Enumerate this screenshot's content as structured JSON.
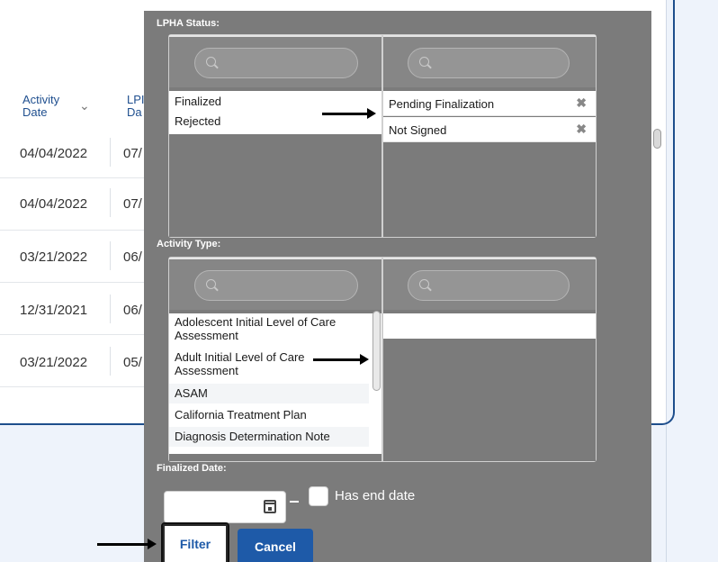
{
  "background_table": {
    "headers": {
      "activity_date": "Activity\nDate",
      "lpha_date": "LPHA\nDate"
    },
    "header_partial_lpha": "LPI",
    "header_partial_lpha_2": "Da",
    "rows": [
      {
        "activity_date": "04/04/2022",
        "lpha_date_partial": "07/"
      },
      {
        "activity_date": "04/04/2022",
        "lpha_date_partial": "07/"
      },
      {
        "activity_date": "03/21/2022",
        "lpha_date_partial": "06/"
      },
      {
        "activity_date": "12/31/2021",
        "lpha_date_partial": "06/"
      },
      {
        "activity_date": "03/21/2022",
        "lpha_date_partial": "05/"
      }
    ]
  },
  "filter_modal": {
    "lpha_status": {
      "label": "LPHA Status:",
      "available": [
        "Finalized",
        "Rejected"
      ],
      "selected": [
        "Pending Finalization",
        "Not Signed"
      ],
      "remove_glyph": "✖"
    },
    "activity_type": {
      "label": "Activity Type:",
      "available": [
        "Adolescent Initial Level of Care Assessment",
        "Adult Initial Level of Care Assessment",
        "ASAM",
        "California Treatment Plan",
        "Diagnosis Determination Note"
      ],
      "selected": []
    },
    "finalized_date": {
      "label": "Finalized Date:",
      "start_value": "",
      "dash": "–",
      "has_end_date_label": "Has end date",
      "has_end_date_checked": false
    },
    "buttons": {
      "filter": "Filter",
      "cancel": "Cancel"
    }
  },
  "colors": {
    "modal_bg": "#7b7b7b",
    "primary": "#1e5aa8",
    "header_text": "#1f4f8f"
  }
}
